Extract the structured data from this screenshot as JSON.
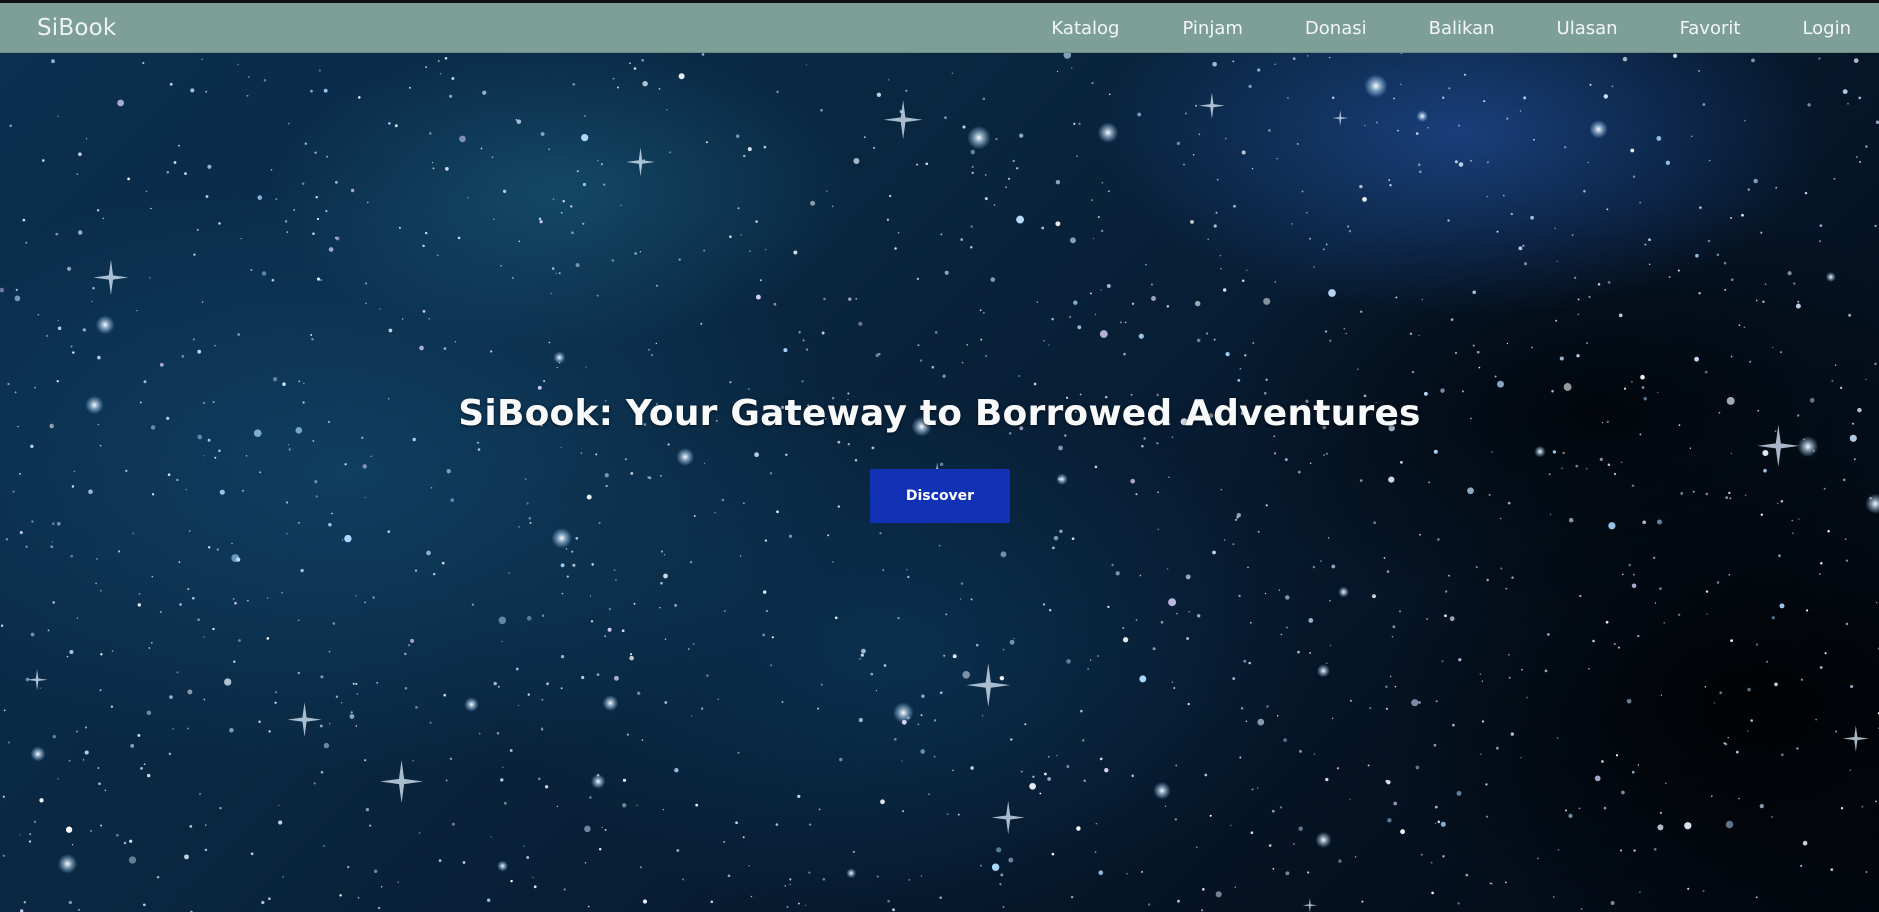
{
  "navbar": {
    "brand": "SiBook",
    "links": [
      {
        "label": "Katalog"
      },
      {
        "label": "Pinjam"
      },
      {
        "label": "Donasi"
      },
      {
        "label": "Balikan"
      },
      {
        "label": "Ulasan"
      },
      {
        "label": "Favorit"
      },
      {
        "label": "Login"
      }
    ],
    "background_color": "#7e9f98",
    "text_color": "#f3f6f5"
  },
  "hero": {
    "title": "SiBook: Your Gateway to Borrowed Adventures",
    "button_label": "Discover",
    "button_color": "#1132b5",
    "background_description_icon": "starfield-background"
  }
}
